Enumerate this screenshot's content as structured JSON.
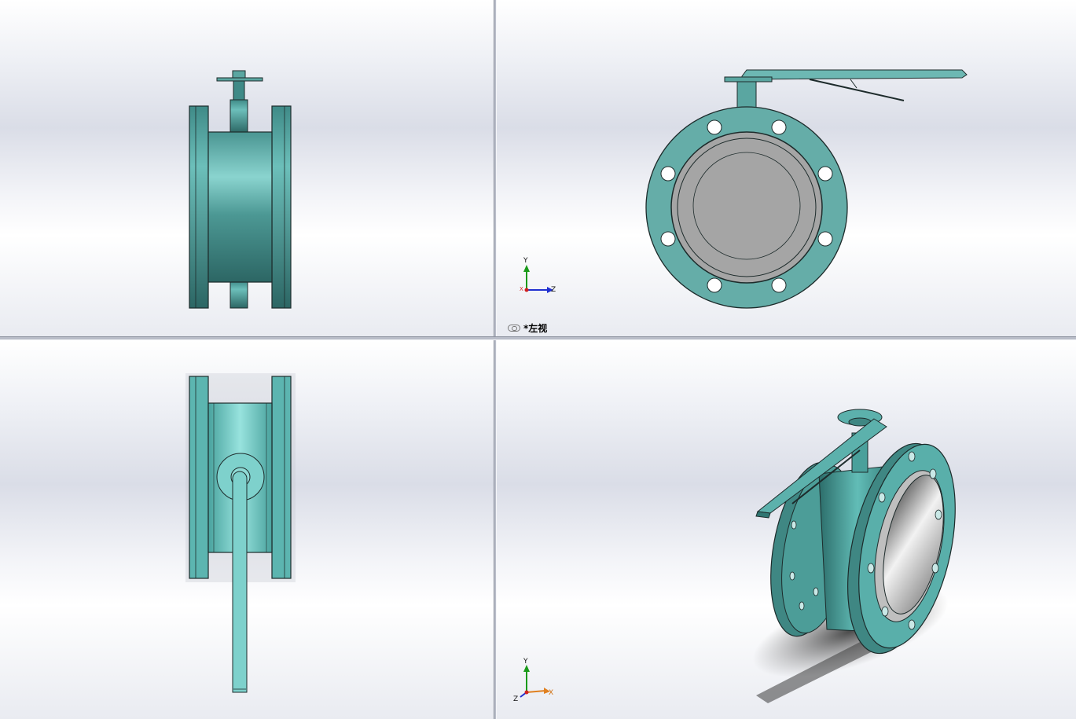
{
  "viewports": {
    "top_left": {
      "name": "front-view"
    },
    "top_right": {
      "name": "left-view",
      "label_prefix": "*",
      "label": "左视",
      "link_icon": "link-views-icon"
    },
    "bottom_left": {
      "name": "top-view"
    },
    "bottom_right": {
      "name": "isometric-view"
    }
  },
  "triad_tr": {
    "y": "Y",
    "z": "Z",
    "x": "X"
  },
  "triad_br": {
    "y": "Y",
    "x": "X",
    "z": "Z"
  },
  "colors": {
    "valve_body": "#5fb0ab",
    "valve_dark": "#2f6e6b",
    "valve_light": "#8fdad5",
    "seat_gray": "#a9a9a9",
    "outline": "#1d2b2b"
  }
}
